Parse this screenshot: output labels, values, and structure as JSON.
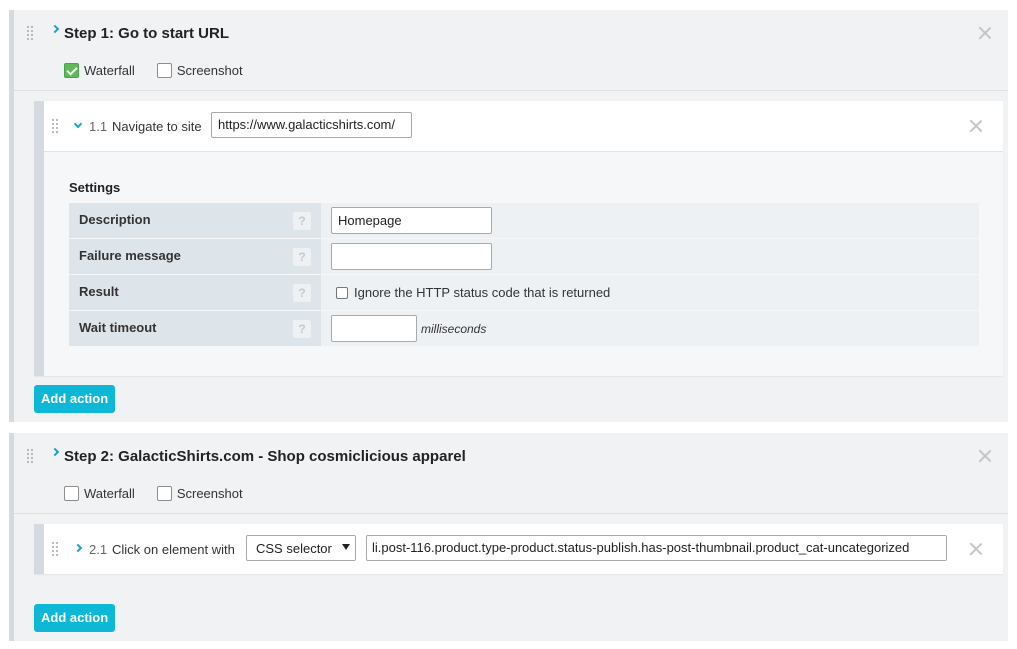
{
  "steps": [
    {
      "title": "Step 1: Go to start URL",
      "options": {
        "waterfall_label": "Waterfall",
        "waterfall_checked": true,
        "screenshot_label": "Screenshot",
        "screenshot_checked": false
      },
      "actions": [
        {
          "number": "1.1",
          "label": "Navigate to site",
          "url_value": "https://www.galacticshirts.com/",
          "expanded": true,
          "settings": {
            "title": "Settings",
            "rows": [
              {
                "label": "Description",
                "help": "?",
                "value": "Homepage"
              },
              {
                "label": "Failure message",
                "help": "?",
                "value": ""
              },
              {
                "label": "Result",
                "help": "?",
                "checkbox_label": "Ignore the HTTP status code that is returned"
              },
              {
                "label": "Wait timeout",
                "help": "?",
                "value": "",
                "unit": "milliseconds"
              }
            ]
          }
        }
      ],
      "add_action_label": "Add action"
    },
    {
      "title": "Step 2: GalacticShirts.com - Shop cosmiclicious apparel",
      "options": {
        "waterfall_label": "Waterfall",
        "waterfall_checked": false,
        "screenshot_label": "Screenshot",
        "screenshot_checked": false
      },
      "actions": [
        {
          "number": "2.1",
          "label": "Click on element with",
          "selector_type": "CSS selector",
          "selector_value": "li.post-116.product.type-product.status-publish.has-post-thumbnail.product_cat-uncategorized",
          "expanded": false
        }
      ],
      "add_action_label": "Add action"
    }
  ],
  "colors": {
    "accent": "#0cb8d6",
    "chevron": "#1aa2c6",
    "checked": "#5fb85a"
  }
}
